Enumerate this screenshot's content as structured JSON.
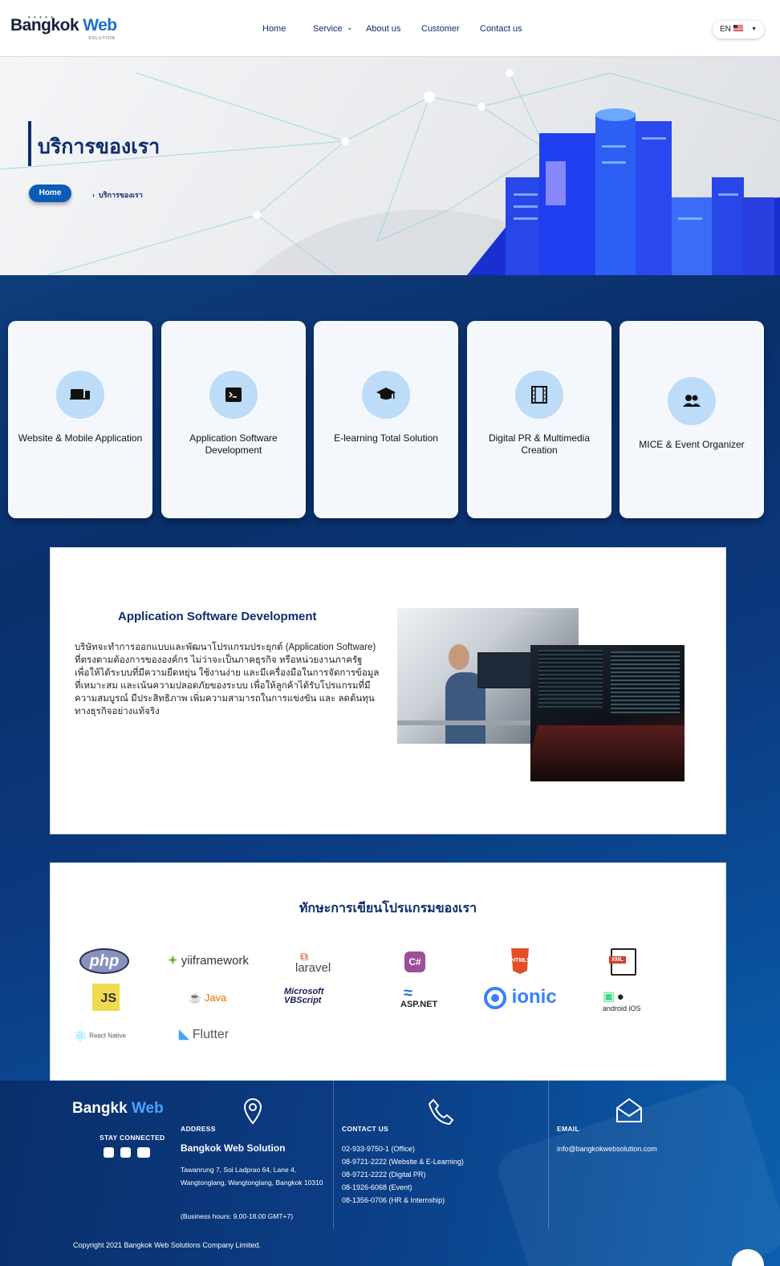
{
  "header": {
    "logo_main": "Bangkok",
    "logo_accent": "Web",
    "logo_sub": "SOLUTION",
    "nav": [
      "Home",
      "Service",
      "About us",
      "Customer",
      "Contact us"
    ],
    "lang": "EN"
  },
  "hero": {
    "title": "บริการของเรา",
    "breadcrumb_home": "Home",
    "breadcrumb_current": "บริการของเรา"
  },
  "services": [
    {
      "label": "Website & Mobile Application",
      "icon": "laptop-mobile-icon"
    },
    {
      "label": "Application Software Development",
      "icon": "terminal-icon"
    },
    {
      "label": "E-learning Total Solution",
      "icon": "graduation-cap-icon"
    },
    {
      "label": "Digital PR & Multimedia Creation",
      "icon": "film-icon"
    },
    {
      "label": "MICE & Event Organizer",
      "icon": "users-icon"
    }
  ],
  "detail": {
    "title": "Application Software Development",
    "text": "บริษัทจะทำการออกแบบและพัฒนาโปรแกรมประยุกต์ (Application Software) ที่ตรงตามต้องการขององค์กร ไม่ว่าจะเป็นภาคธุรกิจ หรือหน่วยงานภาครัฐ เพื่อให้ได้ระบบที่มีความยืดหยุ่น ใช้งานง่าย และมีเครื่องมือในการจัดการข้อมูลที่เหมาะสม และเน้นความปลอดภัยของระบบ เพื่อให้ลูกค้าได้รับโปรแกรมที่มี ความสมบูรณ์ มีประสิทธิภาพ เพิ่มความสามารถในการแข่งขัน และ ลดต้นทุนทางธุรกิจอย่างแท้จริง"
  },
  "skills": {
    "title": "ทักษะการเขียนโปรแกรมของเรา",
    "logos": [
      "php",
      "yiiframework",
      "laravel",
      "C#",
      "HTML5",
      "XML",
      "JS",
      "Java",
      "Microsoft VBScript",
      "ASP.NET",
      "ionic",
      "android iOS",
      "React Native",
      "Flutter"
    ]
  },
  "footer": {
    "logo_main": "Bangk",
    "logo_mid": "k",
    "logo_accent": "Web",
    "stay_connected": "STAY CONNECTED",
    "address_heading": "ADDRESS",
    "company": "Bangkok Web Solution",
    "address": "Tawanrung 7, Soi Ladprao 64, Lane 4, Wangtonglang, Wangtonglang, Bangkok 10310",
    "hours": "(Business hours: 9.00-18.00 GMT+7)",
    "contact_heading": "CONTACT US",
    "phones": [
      "02-933-9750-1 (Office)",
      "08-9721-2222 (Website & E-Learning)",
      "08-9721-2222 (Digital PR)",
      "08-1926-6068 (Event)",
      "08-1356-0706 (HR & Internship)"
    ],
    "email_heading": "EMAIL",
    "email": "info@bangkokwebsolution.com",
    "copyright": "Copyright 2021 Bangkok Web Solutions Company Limited."
  },
  "colors": {
    "navy": "#0d2c6d",
    "accent": "#0b5cb8",
    "card_bg": "#f4f8fd",
    "icon_circle": "#bcdcf7"
  }
}
